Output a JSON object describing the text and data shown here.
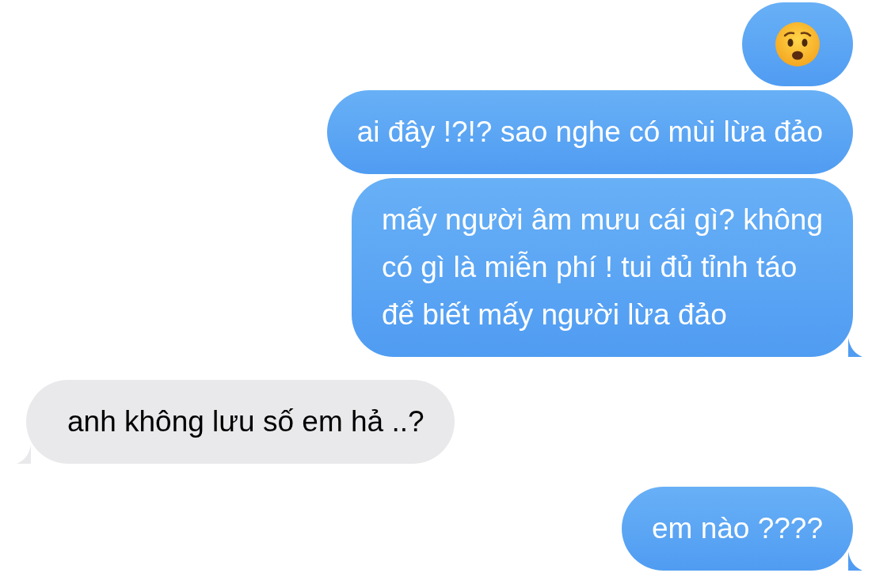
{
  "messages": [
    {
      "kind": "emoji",
      "outgoing": true,
      "tail": false
    },
    {
      "kind": "text",
      "outgoing": true,
      "tail": false,
      "text": "ai đây !?!? sao nghe có mùi lừa đảo"
    },
    {
      "kind": "text",
      "outgoing": true,
      "tail": true,
      "text": "mấy người âm mưu cái gì? không\ncó gì là miễn phí ! tui đủ tỉnh táo\nđể biết mấy người lừa đảo"
    },
    {
      "kind": "text",
      "outgoing": false,
      "tail": true,
      "text": "anh không lưu số em hả ..?"
    },
    {
      "kind": "text",
      "outgoing": true,
      "tail": true,
      "text": "em nào ????"
    }
  ]
}
